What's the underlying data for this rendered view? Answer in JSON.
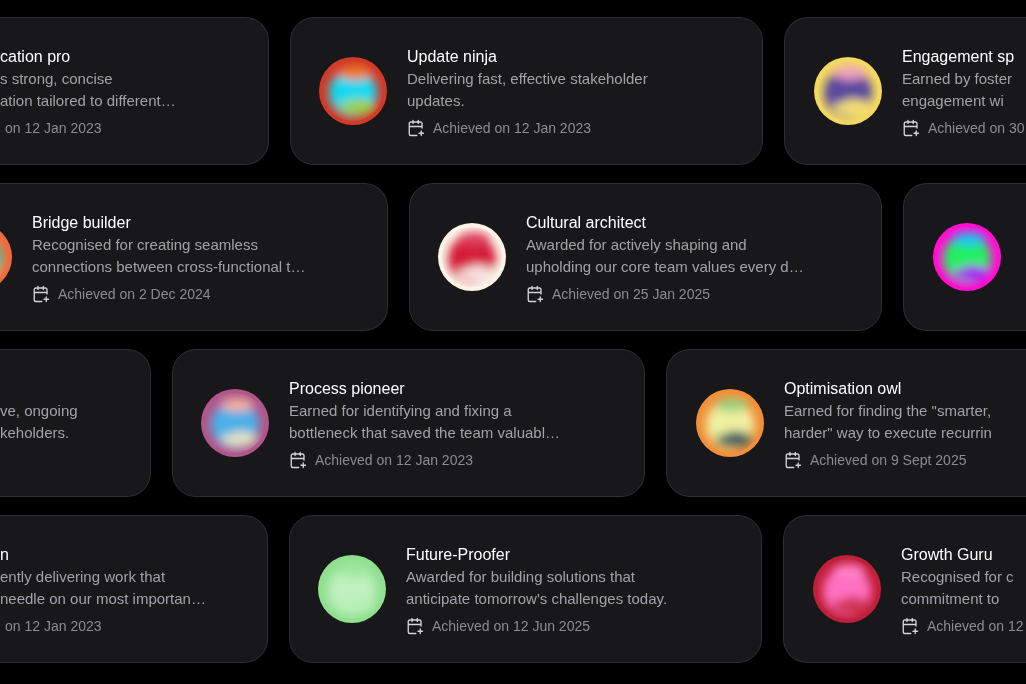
{
  "rows": [
    {
      "cards": [
        {
          "kind": "left",
          "title": "cation pro",
          "description": [
            "s strong, concise",
            "ation tailored to different…"
          ],
          "date": "on 12 Jan 2023"
        },
        {
          "kind": "full",
          "avatar": {
            "kind": "picture"
          },
          "title": "Update ninja",
          "description": [
            "Delivering fast, effective stakeholder",
            "updates."
          ],
          "date": "Achieved on 12 Jan 2023"
        },
        {
          "kind": "right",
          "avatar": {
            "kind": "picture"
          },
          "title": "Engagement sp",
          "description": [
            "Earned by foster",
            "engagement wi"
          ],
          "date": "Achieved on 30"
        }
      ]
    },
    {
      "cards": [
        {
          "kind": "left",
          "avatar": {
            "kind": "picture"
          },
          "title": "Bridge builder",
          "description": [
            "Recognised for creating seamless",
            "connections between cross-functional t…"
          ],
          "date": "Achieved on 2 Dec 2024"
        },
        {
          "kind": "full",
          "avatar": {
            "kind": "picture"
          },
          "title": "Cultural architect",
          "description": [
            "Awarded for actively shaping and",
            "upholding our core team values every d…"
          ],
          "date": "Achieved on 25 Jan 2025"
        },
        {
          "kind": "right",
          "avatar": {
            "kind": "picture"
          }
        }
      ]
    },
    {
      "cards": [
        {
          "kind": "left",
          "description": [
            "ve, ongoing",
            "keholders."
          ]
        },
        {
          "kind": "full",
          "avatar": {
            "kind": "picture"
          },
          "title": "Process pioneer",
          "description": [
            "Earned for identifying and fixing a",
            "bottleneck that saved the team valuabl…"
          ],
          "date": "Achieved on 12 Jan 2023"
        },
        {
          "kind": "right",
          "avatar": {
            "kind": "picture"
          },
          "title": "Optimisation owl",
          "description": [
            "Earned for finding the \"smarter,",
            "harder\" way to execute recurrin"
          ],
          "date": "Achieved on 9 Sept 2025"
        }
      ]
    },
    {
      "cards": [
        {
          "kind": "left",
          "title": "n",
          "description": [
            "ently delivering work that",
            "needle on our most importan…"
          ],
          "date": "on 12 Jan 2023"
        },
        {
          "kind": "full",
          "avatar": {
            "kind": "picture"
          },
          "title": "Future-Proofer",
          "description": [
            "Awarded for building solutions that",
            "anticipate tomorrow's challenges today."
          ],
          "date": "Achieved on 12 Jun 2025"
        },
        {
          "kind": "right",
          "avatar": {
            "kind": "picture"
          },
          "title": "Growth Guru",
          "description": [
            "Recognised for c",
            "commitment to"
          ],
          "date": "Achieved on 12"
        }
      ]
    }
  ]
}
